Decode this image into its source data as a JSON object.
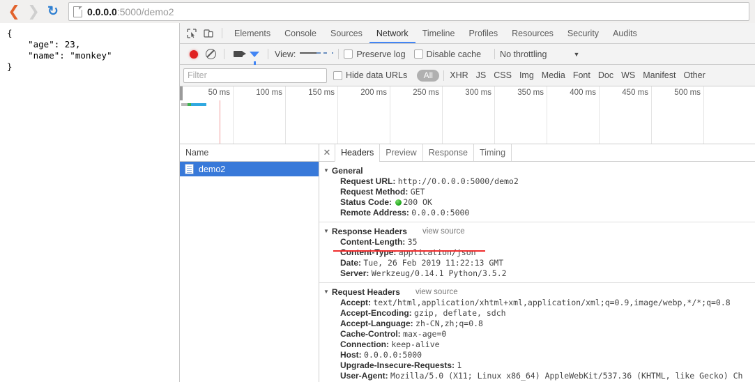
{
  "browser": {
    "back_icon": "back-arrow-icon",
    "forward_icon": "forward-arrow-icon",
    "reload_icon": "reload-icon",
    "page_icon": "page-document-icon",
    "url_host": "0.0.0.0",
    "url_rest": ":5000/demo2"
  },
  "page_content": {
    "json_body": "{\n    \"age\": 23,\n    \"name\": \"monkey\"\n}"
  },
  "devtools": {
    "inspect_icon": "inspect-element-icon",
    "device_icon": "device-toolbar-icon",
    "tabs": [
      {
        "label": "Elements",
        "active": false
      },
      {
        "label": "Console",
        "active": false
      },
      {
        "label": "Sources",
        "active": false
      },
      {
        "label": "Network",
        "active": true
      },
      {
        "label": "Timeline",
        "active": false
      },
      {
        "label": "Profiles",
        "active": false
      },
      {
        "label": "Resources",
        "active": false
      },
      {
        "label": "Security",
        "active": false
      },
      {
        "label": "Audits",
        "active": false
      }
    ],
    "controls": {
      "record_icon": "record-button-icon",
      "clear_icon": "clear-icon",
      "capture_screenshots_icon": "camera-icon",
      "filter_icon": "funnel-filter-icon",
      "view_label": "View:",
      "view_list_icon": "list-view-icon",
      "view_waterfall_icon": "waterfall-view-icon",
      "preserve_log_label": "Preserve log",
      "disable_cache_label": "Disable cache",
      "throttling_value": "No throttling",
      "throttling_caret_icon": "chevron-down-icon"
    },
    "filterbar": {
      "filter_placeholder": "Filter",
      "filter_value": "",
      "hide_data_urls_label": "Hide data URLs",
      "types": [
        "All",
        "XHR",
        "JS",
        "CSS",
        "Img",
        "Media",
        "Font",
        "Doc",
        "WS",
        "Manifest",
        "Other"
      ],
      "selected_type": "All"
    },
    "overview": {
      "ticks": [
        "50 ms",
        "100 ms",
        "150 ms",
        "200 ms",
        "250 ms",
        "300 ms",
        "350 ms",
        "400 ms",
        "450 ms",
        "500 ms"
      ],
      "bar_segments": [
        {
          "color": "#b8b8b8",
          "width": 9
        },
        {
          "color": "#3eb34f",
          "width": 5
        },
        {
          "color": "#2fa8e0",
          "width": 22
        }
      ],
      "red_marker_color": "#f19a9a"
    },
    "requests": {
      "column_header": "Name",
      "rows": [
        {
          "name": "demo2",
          "icon": "document-file-icon",
          "selected": true
        }
      ]
    },
    "detail": {
      "close_icon": "close-icon",
      "tabs": [
        {
          "label": "Headers",
          "active": true
        },
        {
          "label": "Preview",
          "active": false
        },
        {
          "label": "Response",
          "active": false
        },
        {
          "label": "Timing",
          "active": false
        }
      ],
      "sections": [
        {
          "title": "General",
          "triangle_icon": "triangle-down-icon",
          "view_source": "",
          "rows": [
            {
              "key": "Request URL:",
              "value": "http://0.0.0.0:5000/demo2"
            },
            {
              "key": "Request Method:",
              "value": "GET"
            },
            {
              "key": "Status Code:",
              "value": "200 OK",
              "status_dot": true
            },
            {
              "key": "Remote Address:",
              "value": "0.0.0.0:5000"
            }
          ]
        },
        {
          "title": "Response Headers",
          "triangle_icon": "triangle-down-icon",
          "view_source": "view source",
          "rows": [
            {
              "key": "Content-Length:",
              "value": "35"
            },
            {
              "key": "Content-Type:",
              "value": "application/json"
            },
            {
              "key": "Date:",
              "value": "Tue, 26 Feb 2019 11:22:13 GMT"
            },
            {
              "key": "Server:",
              "value": "Werkzeug/0.14.1 Python/3.5.2"
            }
          ]
        },
        {
          "title": "Request Headers",
          "triangle_icon": "triangle-down-icon",
          "view_source": "view source",
          "rows": [
            {
              "key": "Accept:",
              "value": "text/html,application/xhtml+xml,application/xml;q=0.9,image/webp,*/*;q=0.8"
            },
            {
              "key": "Accept-Encoding:",
              "value": "gzip, deflate, sdch"
            },
            {
              "key": "Accept-Language:",
              "value": "zh-CN,zh;q=0.8"
            },
            {
              "key": "Cache-Control:",
              "value": "max-age=0"
            },
            {
              "key": "Connection:",
              "value": "keep-alive"
            },
            {
              "key": "Host:",
              "value": "0.0.0.0:5000"
            },
            {
              "key": "Upgrade-Insecure-Requests:",
              "value": "1"
            },
            {
              "key": "User-Agent:",
              "value": "Mozilla/5.0 (X11; Linux x86_64) AppleWebKit/537.36 (KHTML, like Gecko) Ch"
            }
          ]
        }
      ],
      "annotation": {
        "color": "#ef2b2b",
        "target": "Content-Type: application/json"
      }
    }
  }
}
